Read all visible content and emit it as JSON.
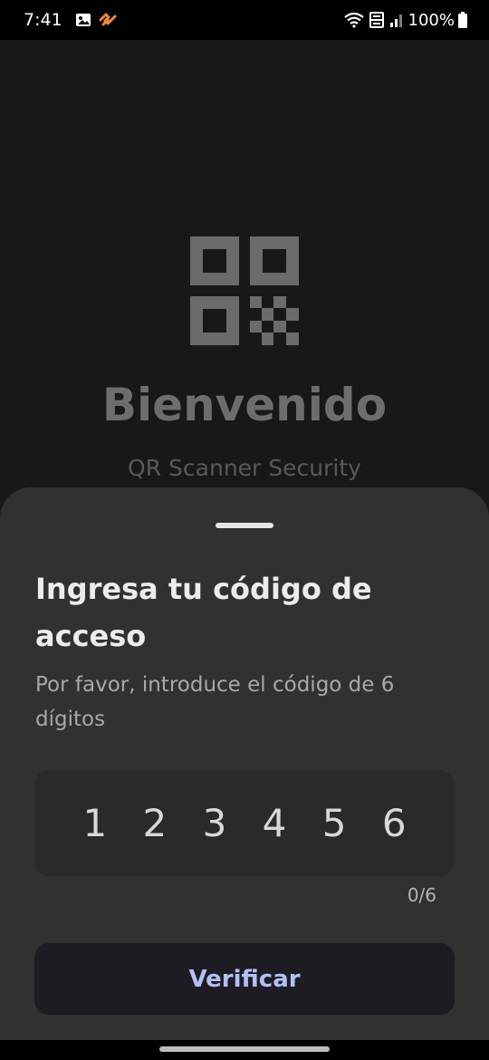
{
  "status_bar": {
    "time": "7:41",
    "battery": "100%",
    "left_icons": [
      "gallery-icon",
      "app-notification-icon"
    ],
    "right_icons": [
      "wifi-icon",
      "volte-4g-icon",
      "signal-icon",
      "battery-icon"
    ]
  },
  "background": {
    "logo_icon": "qr-code-icon",
    "title": "Bienvenido",
    "subtitle": "QR Scanner Security"
  },
  "sheet": {
    "title": "Ingresa tu código de acceso",
    "description": "Por favor, introduce el código de 6 dígitos",
    "code_placeholder": "1 2 3 4 5 6",
    "code_value": "",
    "counter": "0/6",
    "verify_label": "Verificar"
  },
  "colors": {
    "accent": "#b3c0f5",
    "sheet_background": "#313131",
    "screen_background": "#181818"
  }
}
